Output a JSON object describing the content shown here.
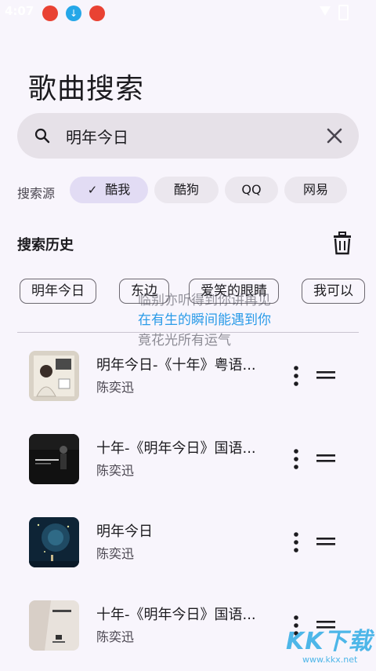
{
  "status_bar": {
    "time": "4:07"
  },
  "page": {
    "title": "歌曲搜索"
  },
  "search": {
    "query": "明年今日"
  },
  "source": {
    "label": "搜索源",
    "options": [
      {
        "label": "酷我",
        "selected": true
      },
      {
        "label": "酷狗",
        "selected": false
      },
      {
        "label": "QQ",
        "selected": false
      },
      {
        "label": "网易",
        "selected": false
      }
    ]
  },
  "history": {
    "title": "搜索历史",
    "items": [
      "明年今日",
      "东边",
      "爱笑的眼睛",
      "我可以"
    ]
  },
  "lyrics_overlay": {
    "lines": [
      "临别亦听得到你讲再见",
      "在有生的瞬间能遇到你",
      "竟花光所有运气"
    ]
  },
  "songs": [
    {
      "title": "明年今日-《十年》粤语...",
      "artist": "陈奕迅"
    },
    {
      "title": "十年-《明年今日》国语...",
      "artist": "陈奕迅"
    },
    {
      "title": "明年今日",
      "artist": "陈奕迅"
    },
    {
      "title": "十年-《明年今日》国语...",
      "artist": "陈奕迅"
    }
  ],
  "watermark": {
    "text": "KK下载",
    "url": "www.kkx.net"
  },
  "colors": {
    "accent": "#2a9be8",
    "chip_selected": "#e2dcf4",
    "background": "#f8f5fc"
  }
}
